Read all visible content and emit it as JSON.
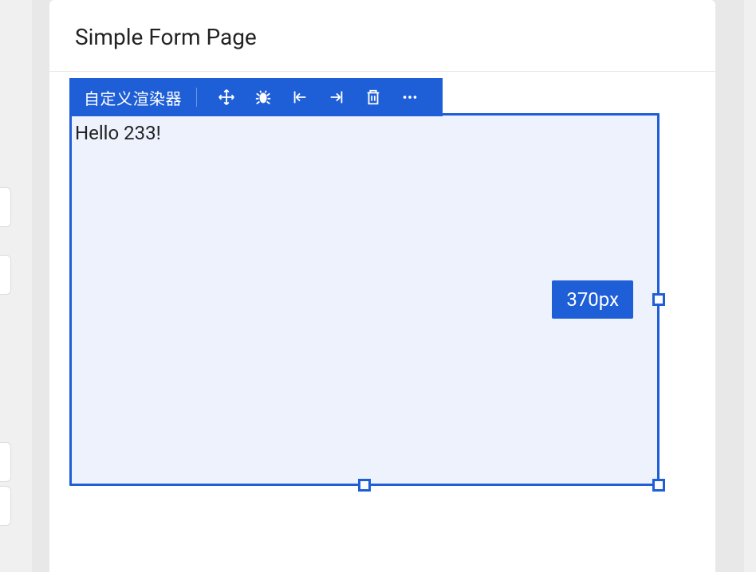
{
  "header": {
    "title": "Simple Form Page"
  },
  "toolbar": {
    "label": "自定义渲染器",
    "icons": {
      "move": "move-icon",
      "bug": "bug-icon",
      "insertBefore": "insert-before-icon",
      "insertAfter": "insert-after-icon",
      "delete": "trash-icon",
      "more": "more-icon"
    }
  },
  "canvas": {
    "content": "Hello 233!",
    "size_label": "370px"
  }
}
